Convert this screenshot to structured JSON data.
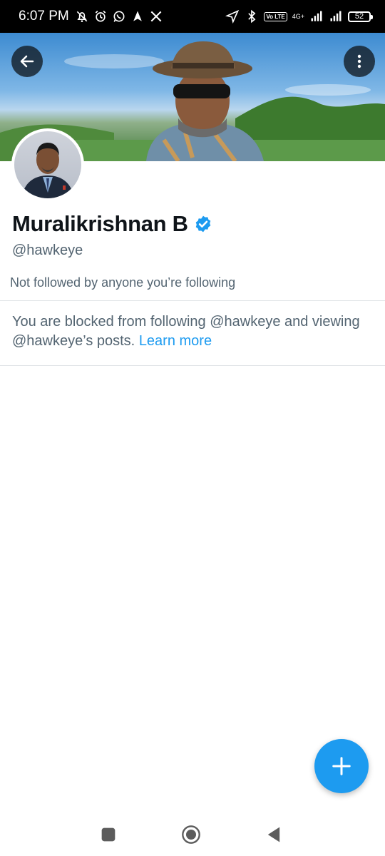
{
  "status_bar": {
    "time": "6:07 PM",
    "left_icons": [
      "bell-off-icon",
      "alarm-icon",
      "whatsapp-icon",
      "navigation-icon",
      "x-logo-icon"
    ],
    "right_icons": [
      "location-arrow-icon",
      "bluetooth-icon",
      "volte-icon",
      "signal-icon",
      "signal-icon-2"
    ],
    "volte_label": "Vo LTE",
    "network_label": "4G+",
    "battery_level": "52"
  },
  "header": {
    "back_icon": "arrow-left-icon",
    "more_icon": "more-vertical-icon"
  },
  "profile": {
    "name": "Muralikrishnan B",
    "verified": true,
    "handle": "@hawkeye",
    "followed_by": "Not followed by anyone you’re following"
  },
  "blocked_notice": {
    "text": "You are blocked from following @hawkeye and viewing @hawkeye’s posts.",
    "link": "Learn more"
  },
  "fab": {
    "icon": "plus-icon"
  },
  "navbar": {
    "icons": [
      "recents-icon",
      "home-icon",
      "back-icon"
    ]
  },
  "colors": {
    "accent": "#1d9bf0",
    "secondary_text": "#536471",
    "primary_text": "#0f1419"
  }
}
